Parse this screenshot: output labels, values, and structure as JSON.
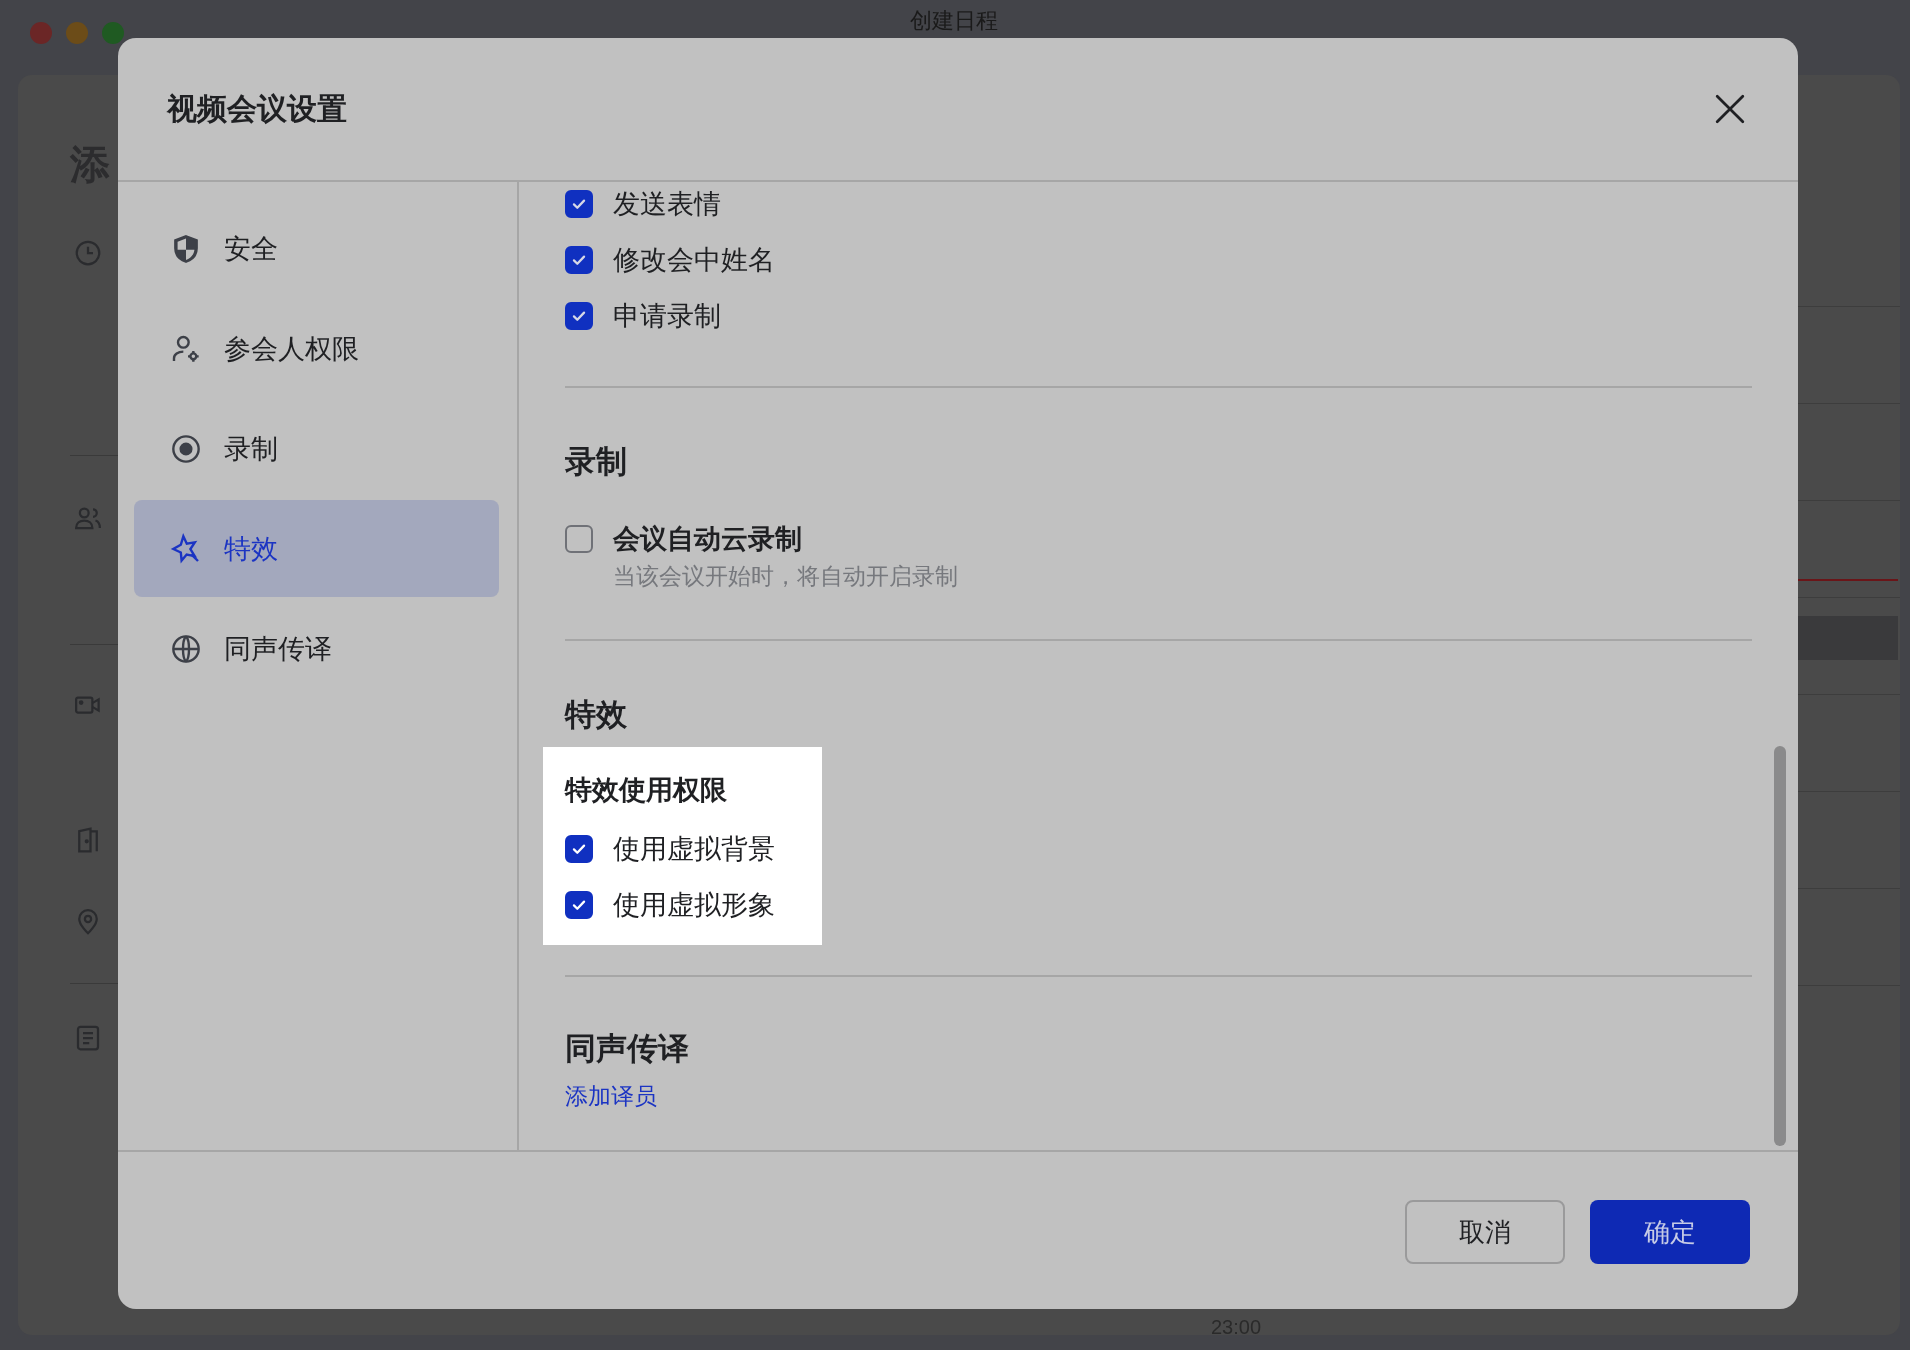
{
  "background_window": {
    "title": "创建日程",
    "heading": "添",
    "time_label": "23:00"
  },
  "dialog": {
    "title": "视频会议设置"
  },
  "sidebar": {
    "items": [
      {
        "label": "安全",
        "selected": false
      },
      {
        "label": "参会人权限",
        "selected": false
      },
      {
        "label": "录制",
        "selected": false
      },
      {
        "label": "特效",
        "selected": true
      },
      {
        "label": "同声传译",
        "selected": false
      }
    ]
  },
  "sections": [
    {
      "kind": "checklist",
      "items": [
        {
          "label": "发送表情",
          "checked": true
        },
        {
          "label": "修改会中姓名",
          "checked": true
        },
        {
          "label": "申请录制",
          "checked": true
        }
      ]
    },
    {
      "kind": "option",
      "heading": "录制",
      "option": {
        "label": "会议自动云录制",
        "description": "当该会议开始时，将自动开启录制",
        "checked": false
      }
    },
    {
      "kind": "permissions",
      "heading": "特效",
      "box": {
        "title": "特效使用权限",
        "items": [
          {
            "label": "使用虚拟背景",
            "checked": true
          },
          {
            "label": "使用虚拟形象",
            "checked": true
          }
        ]
      }
    },
    {
      "kind": "link",
      "heading": "同声传译",
      "link": "添加译员"
    }
  ],
  "buttons": [
    {
      "label": "取消",
      "kind": "secondary"
    },
    {
      "label": "确定",
      "kind": "primary"
    }
  ]
}
